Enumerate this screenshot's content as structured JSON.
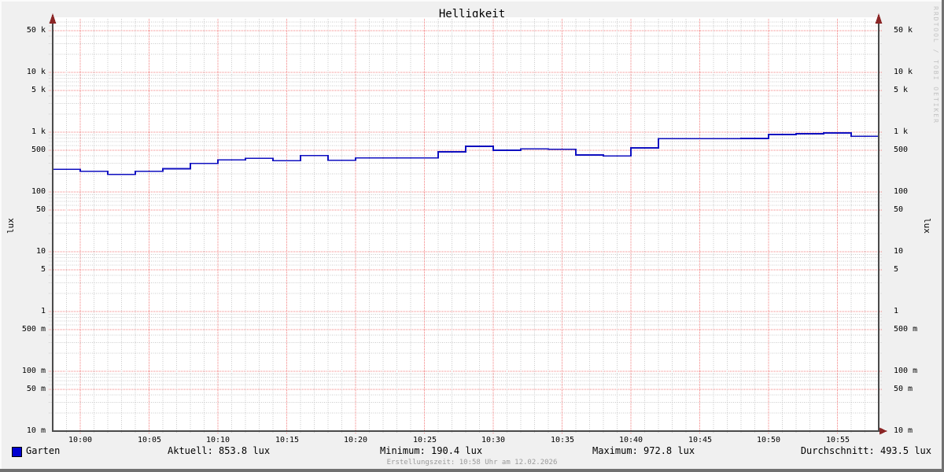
{
  "title": "Helligkeit",
  "watermark": "RRDTOOL / TOBI OETIKER",
  "axis_unit": "lux",
  "legend": {
    "series_label": "Garten"
  },
  "stats_row": {
    "aktuell": "Aktuell: 853.8 lux",
    "minimum": "Minimum: 190.4 lux",
    "maximum": "Maximum: 972.8 lux",
    "durchschnitt": "Durchschnitt: 493.5 lux"
  },
  "footer": "Erstellungszeit: 10:58 Uhr am 12.02.2026",
  "colors": {
    "background": "#f0f0f0",
    "canvas": "#ffffff",
    "major_grid": "#f37f7f",
    "minor_grid": "#c9c9c9",
    "axis": "#4a4a4a",
    "arrow": "#8b2626",
    "line": "#1010c0",
    "swatch": "#0000d0"
  },
  "chart_data": {
    "type": "line",
    "title": "Helligkeit",
    "ylabel": "lux",
    "y_scale": "log",
    "ylim": [
      0.01,
      76000
    ],
    "x_range": [
      "09:58",
      "10:58"
    ],
    "grid": true,
    "legend_position": "bottom-left",
    "step_interval_minutes": 2,
    "y_tick_labels": [
      {
        "value": 50000,
        "label": "50 k"
      },
      {
        "value": 10000,
        "label": "10 k"
      },
      {
        "value": 5000,
        "label": "5 k"
      },
      {
        "value": 1000,
        "label": "1 k"
      },
      {
        "value": 500,
        "label": "500"
      },
      {
        "value": 100,
        "label": "100"
      },
      {
        "value": 50,
        "label": "50"
      },
      {
        "value": 10,
        "label": "10"
      },
      {
        "value": 5,
        "label": "5"
      },
      {
        "value": 1,
        "label": "1"
      },
      {
        "value": 0.5,
        "label": "500 m"
      },
      {
        "value": 0.1,
        "label": "100 m"
      },
      {
        "value": 0.05,
        "label": "50 m"
      },
      {
        "value": 0.01,
        "label": "10 m"
      }
    ],
    "x_tick_labels": [
      "10:00",
      "10:05",
      "10:10",
      "10:15",
      "10:20",
      "10:25",
      "10:30",
      "10:35",
      "10:40",
      "10:45",
      "10:50",
      "10:55"
    ],
    "series": [
      {
        "name": "Garten",
        "color": "#1010c0",
        "style": "step-after",
        "points": [
          {
            "t": "09:58",
            "v": 240
          },
          {
            "t": "10:00",
            "v": 222
          },
          {
            "t": "10:02",
            "v": 196
          },
          {
            "t": "10:04",
            "v": 222
          },
          {
            "t": "10:06",
            "v": 245
          },
          {
            "t": "10:08",
            "v": 300
          },
          {
            "t": "10:10",
            "v": 345
          },
          {
            "t": "10:12",
            "v": 365
          },
          {
            "t": "10:14",
            "v": 335
          },
          {
            "t": "10:16",
            "v": 405
          },
          {
            "t": "10:18",
            "v": 340
          },
          {
            "t": "10:20",
            "v": 370
          },
          {
            "t": "10:22",
            "v": 370
          },
          {
            "t": "10:24",
            "v": 370
          },
          {
            "t": "10:26",
            "v": 470
          },
          {
            "t": "10:28",
            "v": 580
          },
          {
            "t": "10:30",
            "v": 500
          },
          {
            "t": "10:32",
            "v": 528
          },
          {
            "t": "10:34",
            "v": 520
          },
          {
            "t": "10:36",
            "v": 415
          },
          {
            "t": "10:38",
            "v": 400
          },
          {
            "t": "10:40",
            "v": 545
          },
          {
            "t": "10:42",
            "v": 780
          },
          {
            "t": "10:44",
            "v": 780
          },
          {
            "t": "10:46",
            "v": 780
          },
          {
            "t": "10:48",
            "v": 785
          },
          {
            "t": "10:50",
            "v": 915
          },
          {
            "t": "10:52",
            "v": 945
          },
          {
            "t": "10:54",
            "v": 970
          },
          {
            "t": "10:56",
            "v": 854
          }
        ]
      }
    ],
    "stats": {
      "current": 853.8,
      "min": 190.4,
      "max": 972.8,
      "avg": 493.5,
      "unit": "lux"
    }
  }
}
